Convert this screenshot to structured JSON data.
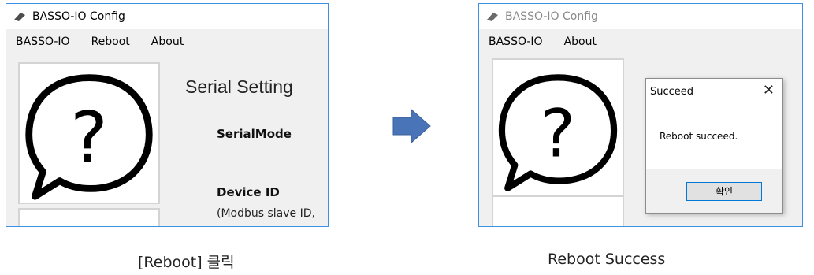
{
  "left_window": {
    "title": "BASSO-IO Config",
    "menu": [
      "BASSO-IO",
      "Reboot",
      "About"
    ],
    "heading": "Serial Setting",
    "serial_mode_label": "SerialMode",
    "device_id_label": "Device ID",
    "device_id_note": "(Modbus slave ID,"
  },
  "right_window": {
    "title": "BASSO-IO Config",
    "menu": [
      "BASSO-IO",
      "About"
    ],
    "dialog": {
      "title": "Succeed",
      "close_glyph": "✕",
      "message": "Reboot succeed.",
      "ok_label": "확인"
    }
  },
  "arrow_color": "#4a74b8",
  "captions": {
    "left": "[Reboot]  클릭",
    "right": "Reboot Success"
  },
  "icons": {
    "app": "app-diamond-icon",
    "help": "question-bubble-icon",
    "arrow": "right-arrow-icon"
  }
}
